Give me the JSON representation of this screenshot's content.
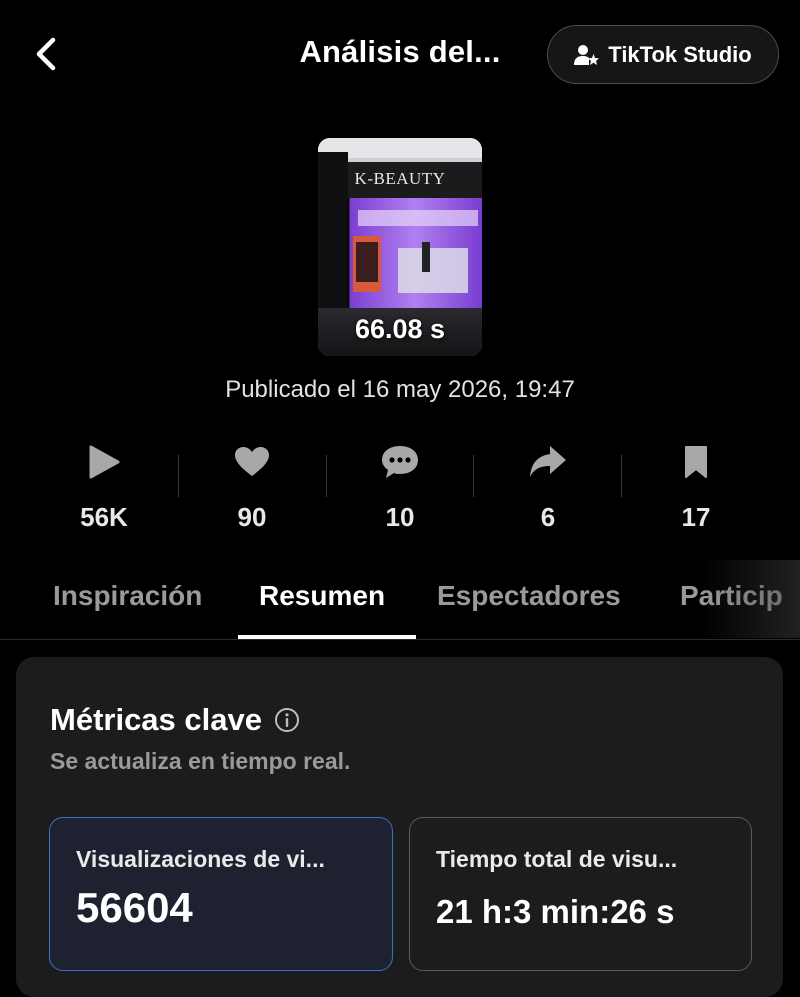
{
  "header": {
    "title": "Análisis del...",
    "studio_label": "TikTok Studio",
    "back_icon": "chevron-left-icon",
    "studio_icon": "user-star-icon"
  },
  "video": {
    "duration": "66.08 s",
    "store_sign": "K-BEAUTY",
    "published": "Publicado el 16 may 2026, 19:47"
  },
  "stats": [
    {
      "icon": "play-icon",
      "value": "56K"
    },
    {
      "icon": "heart-icon",
      "value": "90"
    },
    {
      "icon": "comment-icon",
      "value": "10"
    },
    {
      "icon": "share-icon",
      "value": "6"
    },
    {
      "icon": "bookmark-icon",
      "value": "17"
    }
  ],
  "tabs": [
    {
      "label": "Inspiración",
      "active": false
    },
    {
      "label": "Resumen",
      "active": true
    },
    {
      "label": "Espectadores",
      "active": false
    },
    {
      "label": "Particip",
      "active": false
    }
  ],
  "metrics_card": {
    "title": "Métricas clave",
    "info_icon": "info-icon",
    "subtitle": "Se actualiza en tiempo real.",
    "metrics": [
      {
        "label": "Visualizaciones de vi...",
        "value": "56604",
        "selected": true
      },
      {
        "label": "Tiempo total de visu...",
        "value": "21 h:3 min:26 s",
        "selected": false
      }
    ]
  },
  "colors": {
    "background": "#000000",
    "card": "#1c1c1e",
    "selected_border": "#3f6fc5",
    "muted_text": "#9a9a9a"
  }
}
